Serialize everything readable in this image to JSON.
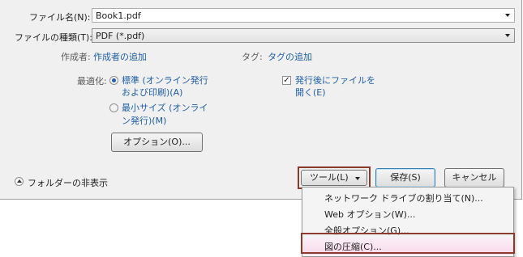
{
  "form": {
    "filename_label": "ファイル名(N):",
    "filename_value": "Book1.pdf",
    "filetype_label": "ファイルの種類(T):",
    "filetype_value": "PDF (*.pdf)",
    "author_label": "作成者:",
    "author_link": "作成者の追加",
    "tags_label": "タグ:",
    "tags_link": "タグの追加"
  },
  "optimize": {
    "label": "最適化:",
    "standard_line1": "標準 (オンライン発行",
    "standard_line2": "および印刷)(A)",
    "minimum_line1": "最小サイズ (オンライ",
    "minimum_line2": "ン発行)(M)",
    "selected": "standard"
  },
  "open_after": {
    "line1": "発行後にファイルを",
    "line2": "開く(E)",
    "checked": true
  },
  "options_button": "オプション(O)...",
  "footer": {
    "hide_folders": "フォルダーの非表示",
    "tools_button": "ツール(L)",
    "save_button": "保存(S)",
    "cancel_button": "キャンセル"
  },
  "tools_menu": {
    "items": [
      "ネットワーク ドライブの割り当て(N)...",
      "Web オプション(W)...",
      "全般オプション(G)...",
      "図の圧縮(C)..."
    ],
    "selected_index": 3
  },
  "colors": {
    "link": "#1f5fa8",
    "highlight_border": "#8b3a2b",
    "selected_item_bg": "#f6d8ea"
  }
}
